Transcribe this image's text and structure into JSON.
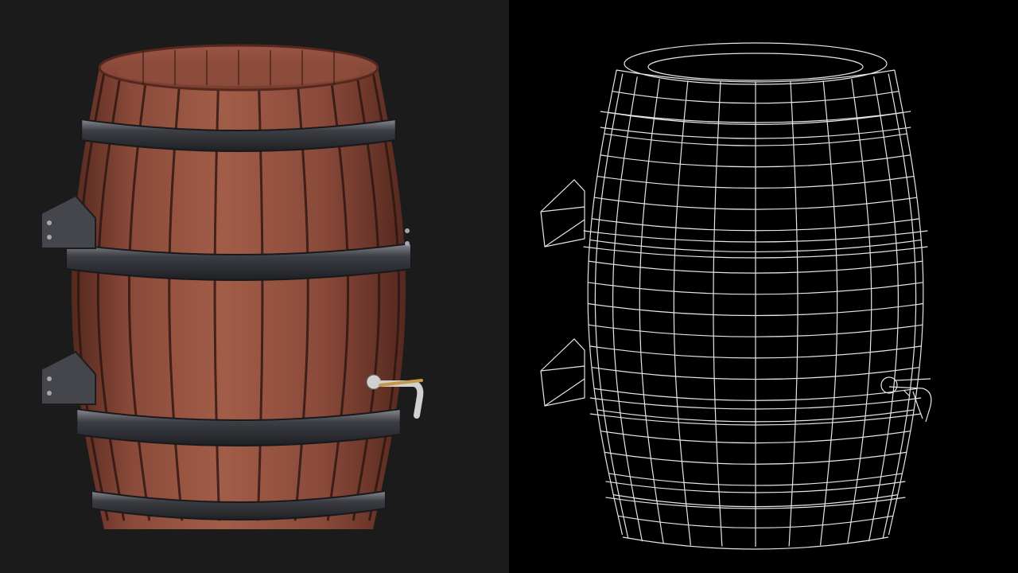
{
  "panels": [
    {
      "id": "rendered",
      "view": "shaded-textured-render",
      "subject": "wooden-barrel",
      "background_color": "#1b1b1b"
    },
    {
      "id": "wireframe",
      "view": "wireframe",
      "subject": "wooden-barrel",
      "background_color": "#000000"
    }
  ],
  "colors": {
    "wood_mid": "#8a4a3a",
    "wood_light": "#a25d48",
    "wood_dark": "#55281e",
    "gap_dark": "#2a1410",
    "iron_band": "#3d3e43",
    "iron_highlight": "#8a8c94",
    "tap_brass": "#c49a4a",
    "tap_steel": "#d0d0d0",
    "wire_line": "#e6e6e6"
  }
}
